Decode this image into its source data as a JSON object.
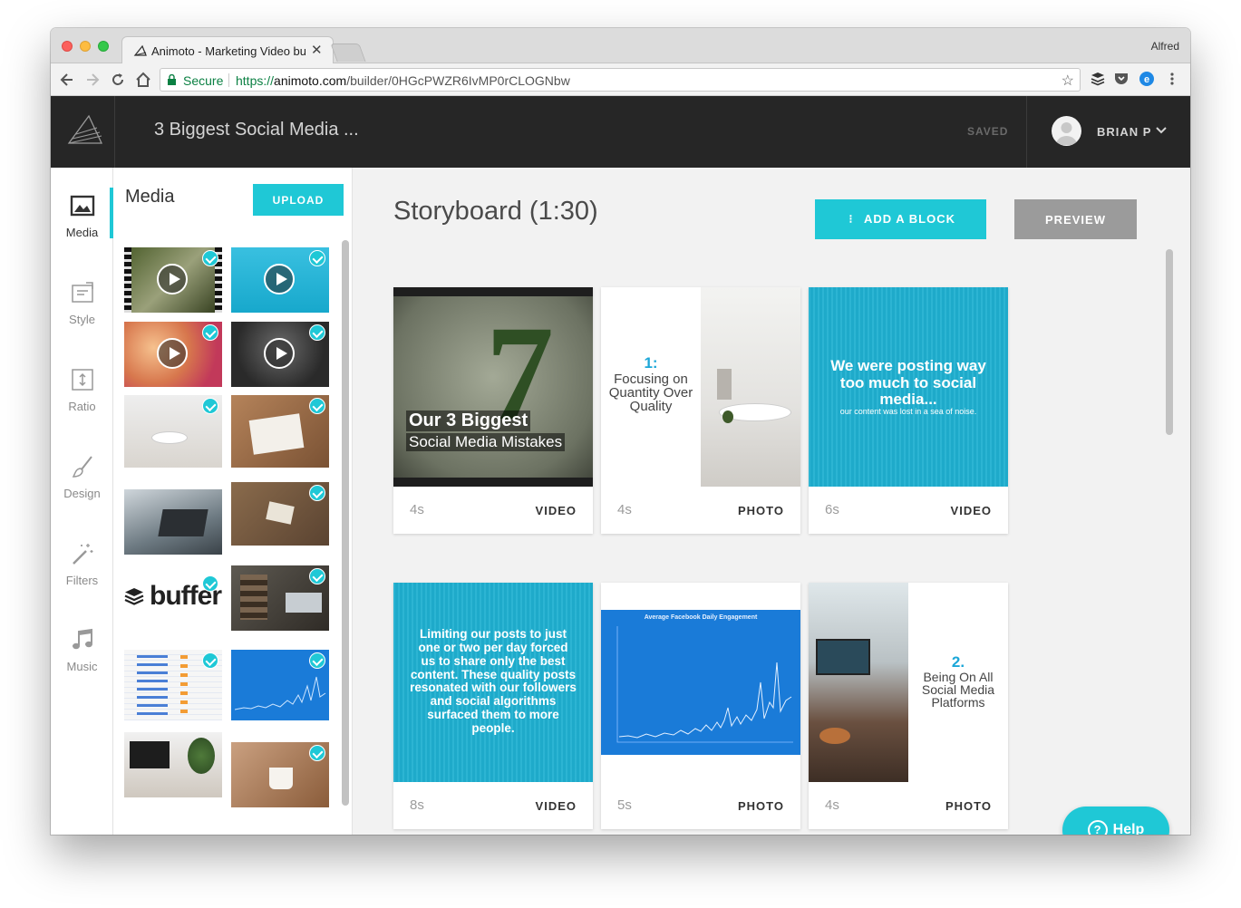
{
  "browser": {
    "tab_title": "Animoto - Marketing Video bui",
    "tab_close": "✕",
    "profile_name": "Alfred",
    "secure_label": "Secure",
    "url_scheme": "https://",
    "url_domain": "animoto.com",
    "url_path": "/builder/0HGcPWZR6IvMP0rCLOGNbw",
    "star": "☆"
  },
  "header": {
    "project_title": "3 Biggest Social Media ...",
    "saved_label": "SAVED",
    "user_name": "BRIAN P"
  },
  "rail": {
    "items": [
      {
        "label": "Media",
        "icon": "image-icon"
      },
      {
        "label": "Style",
        "icon": "style-icon"
      },
      {
        "label": "Ratio",
        "icon": "ratio-icon"
      },
      {
        "label": "Design",
        "icon": "brush-icon"
      },
      {
        "label": "Filters",
        "icon": "magic-wand-icon"
      },
      {
        "label": "Music",
        "icon": "music-note-icon"
      }
    ]
  },
  "media_panel": {
    "title": "Media",
    "upload_label": "UPLOAD",
    "buffer_wordmark": "buffer"
  },
  "storyboard": {
    "title": "Storyboard (1:30)",
    "add_block_label": "ADD A BLOCK",
    "preview_label": "PREVIEW",
    "cards": [
      {
        "duration": "4s",
        "type": "VIDEO",
        "headline": "Our 3 Biggest",
        "subline": "Social Media Mistakes",
        "big_number": "7"
      },
      {
        "duration": "4s",
        "type": "PHOTO",
        "number": "1:",
        "text": "Focusing on Quantity Over Quality"
      },
      {
        "duration": "6s",
        "type": "VIDEO",
        "headline": "We were posting way too much to social media...",
        "subline": "our content was lost in a sea of noise."
      },
      {
        "duration": "8s",
        "type": "VIDEO",
        "headline": "Limiting our posts to just one or two per day forced us to share only the best content. These quality posts resonated with our followers and social algorithms surfaced them to more people."
      },
      {
        "duration": "5s",
        "type": "PHOTO",
        "chart_title": "Average Facebook Daily Engagement"
      },
      {
        "duration": "4s",
        "type": "PHOTO",
        "number": "2.",
        "text": "Being On All Social Media Platforms"
      }
    ]
  },
  "help_label": "Help",
  "colors": {
    "accent": "#1fc8d6",
    "header_bg": "#262626",
    "preview_bg": "#9b9b9b",
    "chart_blue": "#1a7bd8"
  }
}
